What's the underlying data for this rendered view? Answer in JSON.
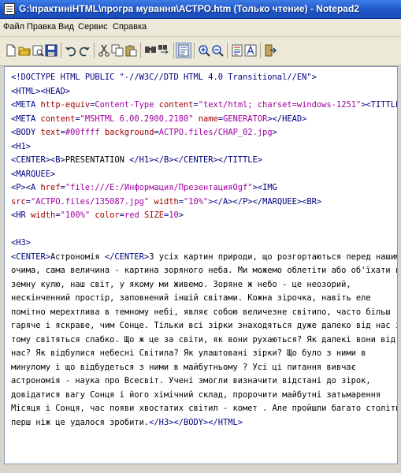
{
  "window": {
    "title": "G:\\практиніHTML\\програ мування\\АСТРО.htm (Только чтение) - Notepad2"
  },
  "menu": {
    "items": [
      "Файл",
      "Правка",
      "Вид",
      "Сервис",
      "Справка"
    ]
  },
  "toolbar": {
    "buttons": [
      "new-icon",
      "open-icon",
      "browse-icon",
      "save-icon",
      "undo-icon",
      "redo-icon",
      "cut-icon",
      "copy-icon",
      "paste-icon",
      "find-icon",
      "replace-icon",
      "word-wrap-icon",
      "zoom-in-icon",
      "zoom-out-icon",
      "scheme-icon",
      "font-icon",
      "exit-icon"
    ]
  },
  "editor": {
    "lines": [
      [
        {
          "t": "tag",
          "v": "<!DOCTYPE HTML PUBLIC \"-//W3C//DTD HTML 4.0 Transitional//EN\">"
        }
      ],
      [
        {
          "t": "tag",
          "v": "<HTML><HEAD>"
        }
      ],
      [
        {
          "t": "tag",
          "v": "<META "
        },
        {
          "t": "attr",
          "v": "http-equiv"
        },
        {
          "t": "tag",
          "v": "="
        },
        {
          "t": "val",
          "v": "Content-Type"
        },
        {
          "t": "tag",
          "v": " "
        },
        {
          "t": "attr",
          "v": "content"
        },
        {
          "t": "tag",
          "v": "="
        },
        {
          "t": "val",
          "v": "\"text/html; charset=windows-1251\""
        },
        {
          "t": "tag",
          "v": "><TITTLE>"
        }
      ],
      [
        {
          "t": "tag",
          "v": "<META "
        },
        {
          "t": "attr",
          "v": "content"
        },
        {
          "t": "tag",
          "v": "="
        },
        {
          "t": "val",
          "v": "\"MSHTML 6.00.2900.2180\""
        },
        {
          "t": "tag",
          "v": " "
        },
        {
          "t": "attr",
          "v": "name"
        },
        {
          "t": "tag",
          "v": "="
        },
        {
          "t": "val",
          "v": "GENERATOR"
        },
        {
          "t": "tag",
          "v": "></HEAD>"
        }
      ],
      [
        {
          "t": "tag",
          "v": "<BODY "
        },
        {
          "t": "attr",
          "v": "text"
        },
        {
          "t": "tag",
          "v": "="
        },
        {
          "t": "val",
          "v": "#00ffff"
        },
        {
          "t": "tag",
          "v": " "
        },
        {
          "t": "attr",
          "v": "background"
        },
        {
          "t": "tag",
          "v": "="
        },
        {
          "t": "val",
          "v": "АСТРО.files/CHAP_02.jpg"
        },
        {
          "t": "tag",
          "v": ">"
        }
      ],
      [
        {
          "t": "tag",
          "v": "<H1>"
        }
      ],
      [
        {
          "t": "tag",
          "v": "<CENTER><B>"
        },
        {
          "t": "ent",
          "v": "PRESENTATION "
        },
        {
          "t": "tag",
          "v": "</H1></B></CENTER></TITTLE>"
        }
      ],
      [
        {
          "t": "tag",
          "v": "<MARQUEE>"
        }
      ],
      [
        {
          "t": "tag",
          "v": "<P><A "
        },
        {
          "t": "attr",
          "v": "href"
        },
        {
          "t": "tag",
          "v": "="
        },
        {
          "t": "val",
          "v": "\"file:///E:/Информация/ПрезентацияOgf\""
        },
        {
          "t": "tag",
          "v": "><IMG"
        }
      ],
      [
        {
          "t": "attr",
          "v": "src"
        },
        {
          "t": "tag",
          "v": "="
        },
        {
          "t": "val",
          "v": "\"АСТРО.files/135087.jpg\""
        },
        {
          "t": "tag",
          "v": " "
        },
        {
          "t": "attr",
          "v": "width"
        },
        {
          "t": "tag",
          "v": "="
        },
        {
          "t": "val",
          "v": "\"10%\""
        },
        {
          "t": "tag",
          "v": "></A></P></MARQUEE><BR>"
        }
      ],
      [
        {
          "t": "tag",
          "v": "<HR "
        },
        {
          "t": "attr",
          "v": "width"
        },
        {
          "t": "tag",
          "v": "="
        },
        {
          "t": "val",
          "v": "\"100%\""
        },
        {
          "t": "tag",
          "v": " "
        },
        {
          "t": "attr",
          "v": "color"
        },
        {
          "t": "tag",
          "v": "="
        },
        {
          "t": "val",
          "v": "red"
        },
        {
          "t": "tag",
          "v": " "
        },
        {
          "t": "attr",
          "v": "SIZE"
        },
        {
          "t": "tag",
          "v": "="
        },
        {
          "t": "val",
          "v": "10"
        },
        {
          "t": "tag",
          "v": ">"
        }
      ],
      [],
      [
        {
          "t": "tag",
          "v": "<H3>"
        }
      ],
      [
        {
          "t": "tag",
          "v": "<CENTER>"
        },
        {
          "t": "ent",
          "v": "Астрономія "
        },
        {
          "t": "tag",
          "v": "</CENTER>"
        },
        {
          "t": "ent",
          "v": "З усіх картин природи, що розгортаються перед нашими"
        }
      ],
      [
        {
          "t": "ent",
          "v": "очима, сама величина - картина зоряного неба. Ми можемо облетіти або об'їхати всю"
        }
      ],
      [
        {
          "t": "ent",
          "v": "земну кулю, наш світ, у якому ми живемо. Зоряне ж небо - це неозорий,"
        }
      ],
      [
        {
          "t": "ent",
          "v": "нескінченний простір, заповнений іншій світами. Кожна зірочка, навіть еле"
        }
      ],
      [
        {
          "t": "ent",
          "v": "помітно мерехтлива в темному небі, являє собою величезне світило, часто більш"
        }
      ],
      [
        {
          "t": "ent",
          "v": "гаряче і яскраве, чим Сонце. Тільки всі зірки знаходяться дуже далеко від нас і"
        }
      ],
      [
        {
          "t": "ent",
          "v": "тому світяться слабко. Що ж це за світи, як вони рухаються? Як далекі вони від"
        }
      ],
      [
        {
          "t": "ent",
          "v": "нас? Як відбулися небесні Світила? Як улаштовані зірки? Що було з ними в"
        }
      ],
      [
        {
          "t": "ent",
          "v": "минулому і що відбудеться з ними в майбутньому ? Усі ці питання вивчає"
        }
      ],
      [
        {
          "t": "ent",
          "v": "астрономія - наука про Всесвіт. Учені змогли визначити відстані до зірок,"
        }
      ],
      [
        {
          "t": "ent",
          "v": "довідатися вагу Сонця і його хімічний склад, пророчити майбутні затьмарення"
        }
      ],
      [
        {
          "t": "ent",
          "v": "Місяця і Сонця, час появи хвостатих світил - комет . Але пройшли багато століть,"
        }
      ],
      [
        {
          "t": "ent",
          "v": "перш ніж це удалося зробити."
        },
        {
          "t": "tag",
          "v": "</H3></BODY></HTML>"
        }
      ]
    ]
  }
}
